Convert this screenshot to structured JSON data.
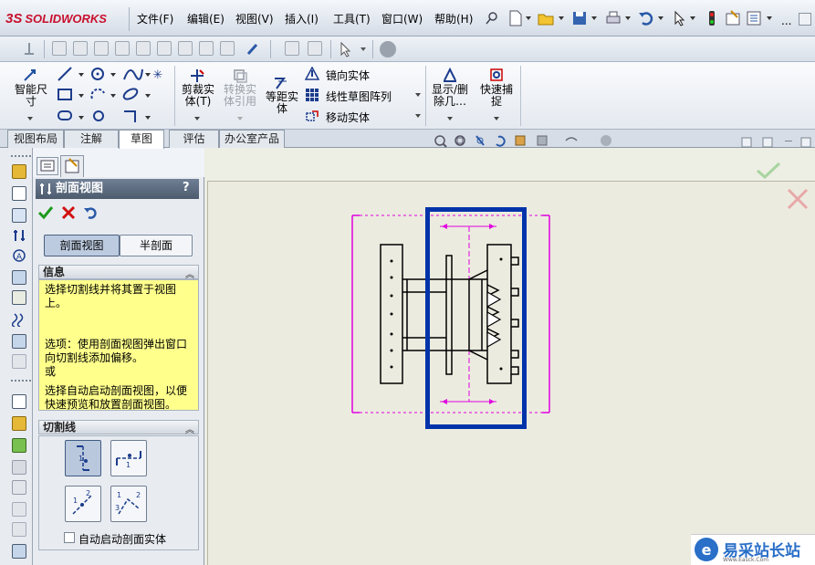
{
  "app": {
    "logo_text": "SOLIDWORKS",
    "logo_mark": "3S"
  },
  "menu": [
    {
      "label": "文件(F)"
    },
    {
      "label": "编辑(E)"
    },
    {
      "label": "视图(V)"
    },
    {
      "label": "插入(I)"
    },
    {
      "label": "工具(T)"
    },
    {
      "label": "窗口(W)"
    },
    {
      "label": "帮助(H)"
    }
  ],
  "toolbar_extra": {
    "ellipsis": "..."
  },
  "ribbon": {
    "smart_dim": [
      "智能尺",
      "寸"
    ],
    "trim": [
      "剪裁实",
      "体(T)"
    ],
    "convert": [
      "转换实",
      "体引用"
    ],
    "offset": [
      "等距实",
      "体"
    ],
    "mirror": "镜向实体",
    "linear_pattern": "线性草图阵列",
    "move": "移动实体",
    "display_delete": [
      "显示/删",
      "除几…"
    ],
    "quick_snap": [
      "快速捕",
      "捉"
    ]
  },
  "tabs": [
    "视图布局",
    "注解",
    "草图",
    "评估",
    "办公室产品"
  ],
  "active_tab": "草图",
  "property_manager": {
    "title": "剖面视图",
    "help": "?",
    "mode_buttons": [
      "剖面视图",
      "半剖面"
    ],
    "info_header": "信息",
    "info_lines": [
      "选择切割线并将其置于视图上。",
      "",
      "选项：使用剖面视图弹出窗口向切割线添加偏移。",
      "或",
      "",
      "选择自动启动剖面视图，以便快速预览和放置剖面视图。"
    ],
    "cutline_header": "切割线",
    "checkbox_label": "自动启动剖面实体"
  },
  "watermark": {
    "text": "易采站长站",
    "sub": "Www.Easck.Com"
  },
  "colors": {
    "selection": "#0033aa",
    "bounds": "#e000e0",
    "accent": "#c8102e"
  }
}
